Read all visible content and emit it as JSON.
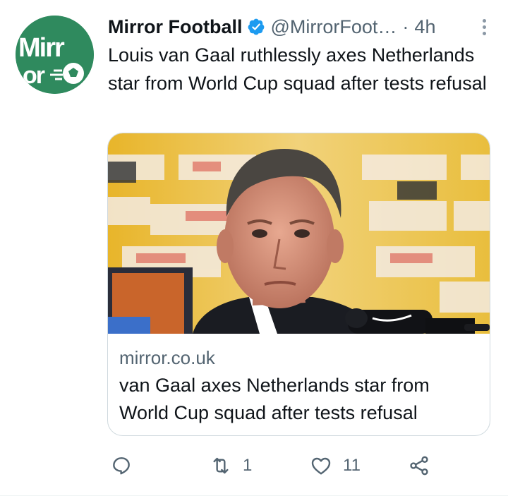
{
  "account": {
    "display_name": "Mirror Football",
    "handle": "@MirrorFoot…",
    "separator": "·",
    "time": "4h",
    "avatar_text": "Mirror",
    "verified_color": "#1d9bf0",
    "brand_color": "#2f8a5e"
  },
  "tweet": {
    "text": "Louis van Gaal ruthlessly axes Netherlands star from World Cup squad after tests refusal"
  },
  "card": {
    "domain": "mirror.co.uk",
    "title": "van Gaal axes Netherlands star from World Cup squad after tests refusal",
    "image_icon": "press-conference-photo"
  },
  "actions": {
    "reply_icon": "reply-icon",
    "retweet_icon": "retweet-icon",
    "retweet_count": "1",
    "like_icon": "heart-icon",
    "like_count": "11",
    "share_icon": "share-icon"
  }
}
